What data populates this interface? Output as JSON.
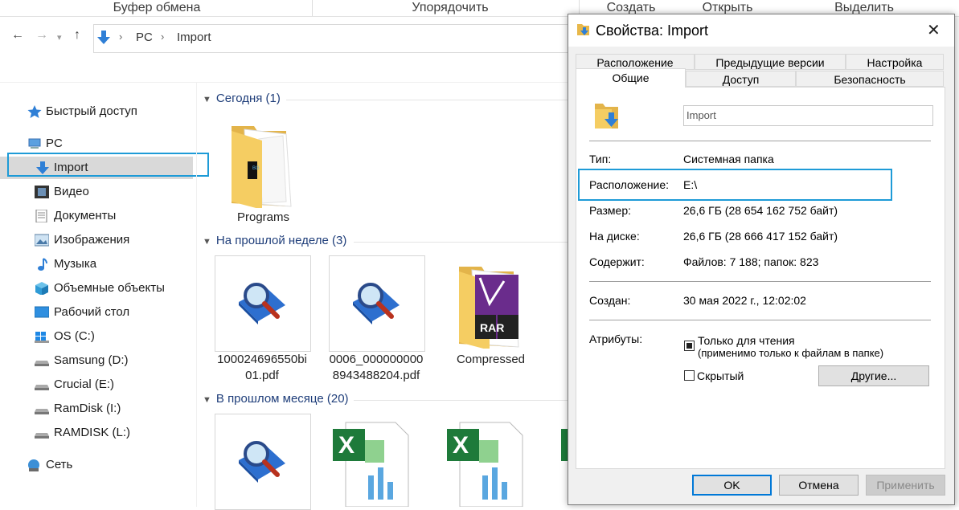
{
  "ribbon": {
    "groups": [
      "Буфер обмена",
      "Упорядочить",
      "Создать",
      "Открыть",
      "Выделить"
    ]
  },
  "nav": {
    "back_icon": "arrow-left-icon",
    "forward_icon": "arrow-right-icon",
    "recent_icon": "chevron-down-icon",
    "up_icon": "arrow-up-icon",
    "breadcrumb": [
      "PC",
      "Import"
    ]
  },
  "sidebar": {
    "items": [
      {
        "label": "Быстрый доступ",
        "icon": "star-icon"
      },
      {
        "label": "PC",
        "icon": "computer-icon"
      },
      {
        "label": "Import",
        "icon": "download-arrow-icon"
      },
      {
        "label": "Видео",
        "icon": "film-icon"
      },
      {
        "label": "Документы",
        "icon": "document-icon"
      },
      {
        "label": "Изображения",
        "icon": "picture-icon"
      },
      {
        "label": "Музыка",
        "icon": "music-note-icon"
      },
      {
        "label": "Объемные объекты",
        "icon": "cube-icon"
      },
      {
        "label": "Рабочий стол",
        "icon": "desktop-icon"
      },
      {
        "label": "OS (C:)",
        "icon": "windows-drive-icon"
      },
      {
        "label": "Samsung (D:)",
        "icon": "drive-icon"
      },
      {
        "label": "Crucial (E:)",
        "icon": "drive-icon"
      },
      {
        "label": "RamDisk (I:)",
        "icon": "drive-icon"
      },
      {
        "label": "RAMDISK (L:)",
        "icon": "drive-icon"
      },
      {
        "label": "Сеть",
        "icon": "network-icon"
      }
    ]
  },
  "content": {
    "groups": [
      {
        "title": "Сегодня (1)",
        "items": [
          "Programs"
        ]
      },
      {
        "title": "На прошлой неделе (3)",
        "items": [
          "100024696550bi\n01.pdf",
          "0006_000000000\n8943488204.pdf",
          "Compressed"
        ]
      },
      {
        "title": "В прошлом месяце (20)",
        "items": []
      }
    ],
    "badge_bg": "BG",
    "badge_rar": "RAR"
  },
  "dialog": {
    "title": "Свойства: Import",
    "close": "✕",
    "tabs_row1": [
      "Расположение",
      "Предыдущие версии",
      "Настройка"
    ],
    "tabs_row2": [
      "Общие",
      "Доступ",
      "Безопасность"
    ],
    "name_value": "Import",
    "rows": [
      {
        "label": "Тип:",
        "value": "Системная папка"
      },
      {
        "label": "Расположение:",
        "value": "E:\\"
      },
      {
        "label": "Размер:",
        "value": "26,6 ГБ (28 654 162 752 байт)"
      },
      {
        "label": "На диске:",
        "value": "26,6 ГБ (28 666 417 152 байт)"
      },
      {
        "label": "Содержит:",
        "value": "Файлов: 7 188; папок: 823"
      },
      {
        "label": "Создан:",
        "value": "30 мая 2022 г., 12:02:02"
      }
    ],
    "attributes_label": "Атрибуты:",
    "readonly_line1": "Только для чтения",
    "readonly_line2": "(применимо только к файлам в папке)",
    "readonly_checked": true,
    "hidden_label": "Скрытый",
    "hidden_checked": false,
    "other_button": "Другие...",
    "ok": "OK",
    "cancel": "Отмена",
    "apply": "Применить"
  },
  "colors": {
    "highlight": "#1e9bd7",
    "folder": "#f2c94c",
    "link_blue": "#1f3e7a"
  }
}
